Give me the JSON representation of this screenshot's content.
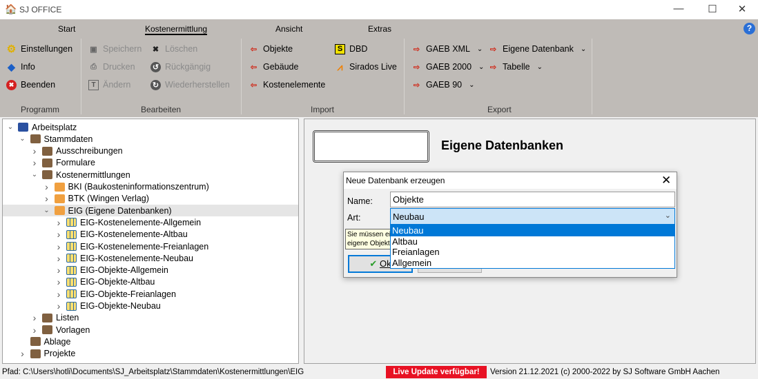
{
  "app": {
    "title": "SJ OFFICE"
  },
  "tabs": [
    "Start",
    "Kostenermittlung",
    "Ansicht",
    "Extras"
  ],
  "ribbon": {
    "programm": {
      "label": "Programm",
      "items": [
        "Einstellungen",
        "Info",
        "Beenden"
      ]
    },
    "bearbeiten": {
      "label": "Bearbeiten",
      "items": [
        "Speichern",
        "Drucken",
        "Ändern",
        "Löschen",
        "Rückgängig",
        "Wiederherstellen"
      ]
    },
    "import": {
      "label": "Import",
      "items": [
        "Objekte",
        "Gebäude",
        "Kostenelemente",
        "DBD",
        "Sirados Live"
      ]
    },
    "export": {
      "label": "Export",
      "items": [
        "GAEB XML",
        "GAEB 2000",
        "GAEB 90",
        "Eigene Datenbank",
        "Tabelle"
      ]
    }
  },
  "tree": [
    {
      "label": "Arbeitsplatz",
      "level": 0,
      "state": "open"
    },
    {
      "label": "Stammdaten",
      "level": 1,
      "state": "open"
    },
    {
      "label": "Ausschreibungen",
      "level": 2,
      "state": "closed"
    },
    {
      "label": "Formulare",
      "level": 2,
      "state": "closed"
    },
    {
      "label": "Kostenermittlungen",
      "level": 2,
      "state": "open"
    },
    {
      "label": "BKI (Baukosteninformationszentrum)",
      "level": 3,
      "state": "closed"
    },
    {
      "label": "BTK (Wingen Verlag)",
      "level": 3,
      "state": "closed"
    },
    {
      "label": "EIG (Eigene Datenbanken)",
      "level": 3,
      "state": "open",
      "selected": true
    },
    {
      "label": "EIG-Kostenelemente-Allgemein",
      "level": 4,
      "state": "closed"
    },
    {
      "label": "EIG-Kostenelemente-Altbau",
      "level": 4,
      "state": "closed"
    },
    {
      "label": "EIG-Kostenelemente-Freianlagen",
      "level": 4,
      "state": "closed"
    },
    {
      "label": "EIG-Kostenelemente-Neubau",
      "level": 4,
      "state": "closed"
    },
    {
      "label": "EIG-Objekte-Allgemein",
      "level": 4,
      "state": "closed"
    },
    {
      "label": "EIG-Objekte-Altbau",
      "level": 4,
      "state": "closed"
    },
    {
      "label": "EIG-Objekte-Freianlagen",
      "level": 4,
      "state": "closed"
    },
    {
      "label": "EIG-Objekte-Neubau",
      "level": 4,
      "state": "closed"
    },
    {
      "label": "Listen",
      "level": 2,
      "state": "closed"
    },
    {
      "label": "Vorlagen",
      "level": 2,
      "state": "closed"
    },
    {
      "label": "Ablage",
      "level": 1,
      "state": "none"
    },
    {
      "label": "Projekte",
      "level": 1,
      "state": "closed"
    }
  ],
  "main": {
    "title": "Eigene Datenbanken"
  },
  "dialog": {
    "title": "Neue Datenbank erzeugen",
    "name_label": "Name:",
    "name_value": "Objekte",
    "art_label": "Art:",
    "art_value": "Neubau",
    "options": [
      "Neubau",
      "Altbau",
      "Freianlagen",
      "Allgemein"
    ],
    "hint_line1": "Sie müssen ei",
    "hint_line2": "eigene Objekt",
    "ok_label": "Ok"
  },
  "status": {
    "path": "Pfad: C:\\Users\\hotli\\Documents\\SJ_Arbeitsplatz\\Stammdaten\\Kostenermittlungen\\EIG",
    "update": "Live Update verfügbar!",
    "version": "Version 21.12.2021  (c) 2000-2022 by SJ Software GmbH Aachen"
  },
  "colors": {
    "ribbon": "#bfbbb7",
    "accent": "#0078d7",
    "update": "#e81123"
  }
}
